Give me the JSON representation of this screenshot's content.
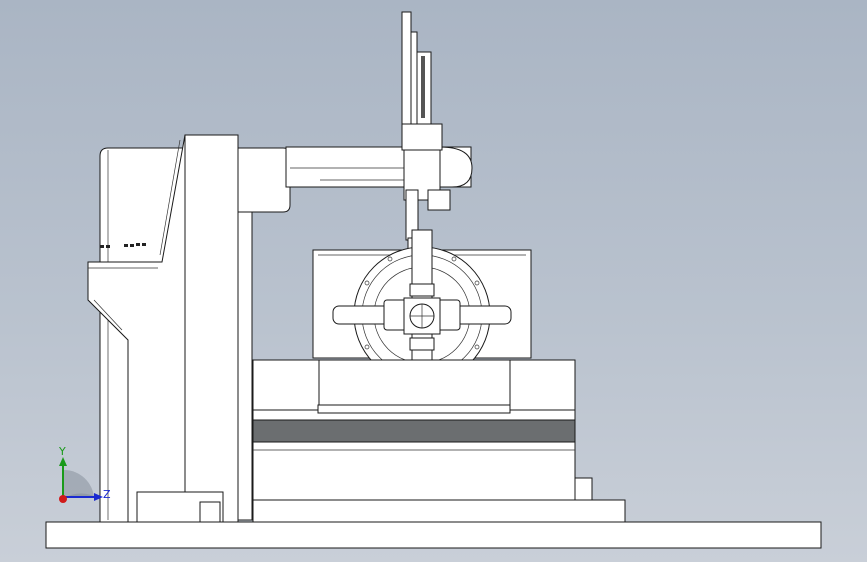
{
  "triad": {
    "y_label": "Y",
    "z_label": "Z",
    "y_color": "#1a9a1a",
    "z_color": "#1a2ad0",
    "origin_color": "#d01a1a"
  },
  "colors": {
    "background_top": "#aab5c4",
    "background_bottom": "#c9cfd8",
    "line": "#1a1a1a",
    "part_fill": "#ffffff",
    "band_fill": "#6b6e70"
  }
}
